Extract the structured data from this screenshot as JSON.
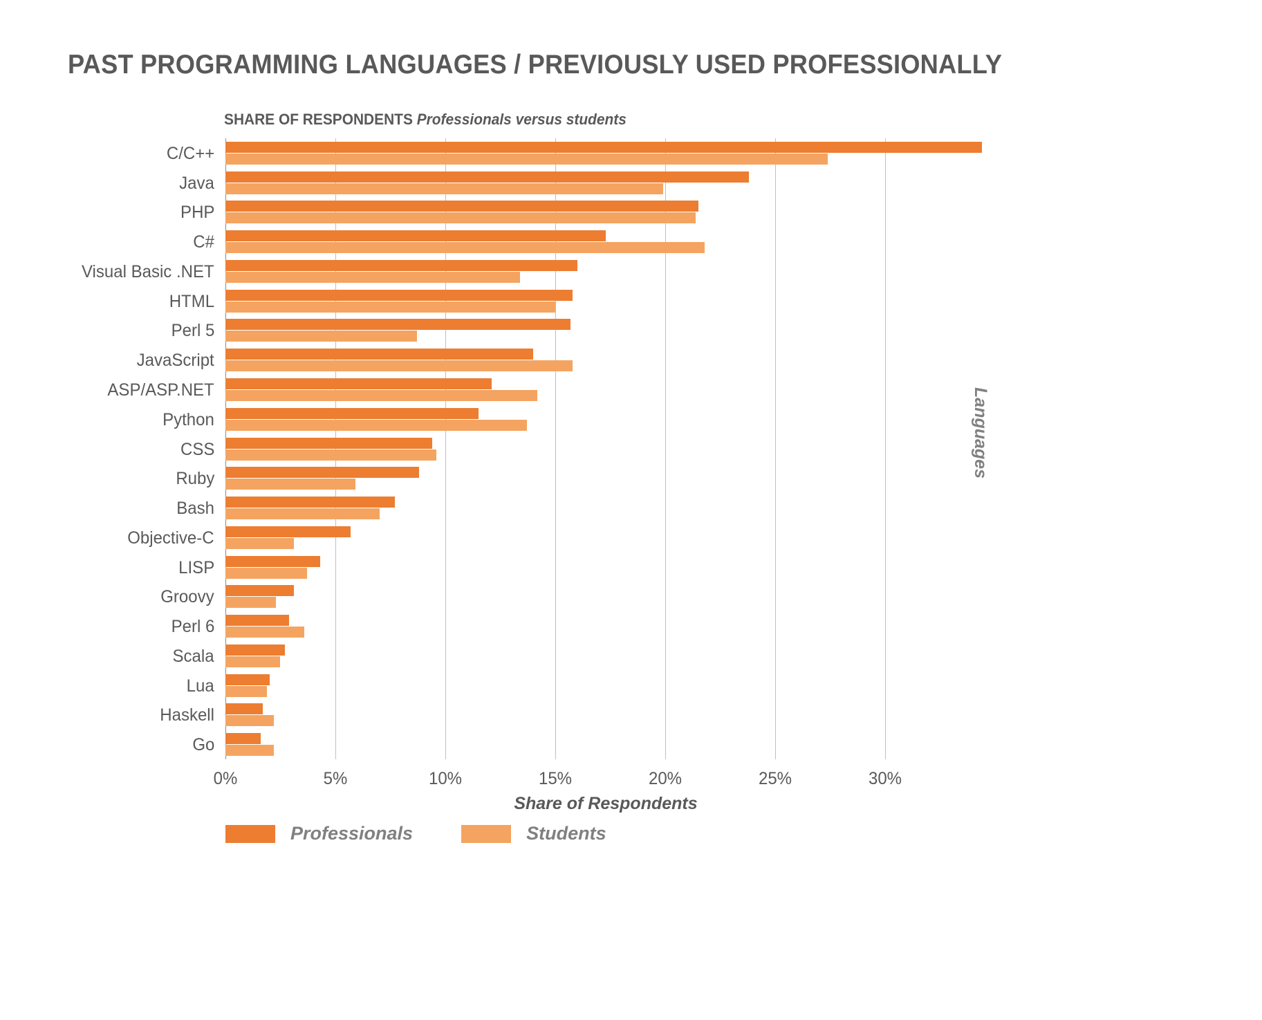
{
  "title": "PAST PROGRAMMING LANGUAGES / PREVIOUSLY USED PROFESSIONALLY",
  "subtitle": {
    "strong": "SHARE OF RESPONDENTS",
    "em": "Professionals versus students"
  },
  "axis": {
    "x_title": "Share of Respondents",
    "y_title": "Languages"
  },
  "legend": [
    {
      "label": "Professionals",
      "color": "#ED7D31"
    },
    {
      "label": "Students",
      "color": "#F4A460"
    }
  ],
  "colors": {
    "professionals": "#ED7D31",
    "students": "#F4A460",
    "text": "#595959",
    "gridline": "#bfbfbf",
    "axis": "#8c8c8c"
  },
  "chart_data": {
    "type": "bar",
    "orientation": "horizontal",
    "title": "PAST PROGRAMMING LANGUAGES / PREVIOUSLY USED PROFESSIONALLY",
    "subtitle": "SHARE OF RESPONDENTS Professionals versus students",
    "xlabel": "Share of Respondents",
    "ylabel": "Languages",
    "xlim": [
      0,
      34.6
    ],
    "xticks": [
      0,
      5,
      10,
      15,
      20,
      25,
      30
    ],
    "xtick_labels": [
      "0%",
      "5%",
      "10%",
      "15%",
      "20%",
      "25%",
      "30%"
    ],
    "grid": true,
    "legend_position": "bottom-left",
    "categories": [
      "C/C++",
      "Java",
      "PHP",
      "C#",
      "Visual Basic .NET",
      "HTML",
      "Perl 5",
      "JavaScript",
      "ASP/ASP.NET",
      "Python",
      "CSS",
      "Ruby",
      "Bash",
      "Objective-C",
      "LISP",
      "Groovy",
      "Perl 6",
      "Scala",
      "Lua",
      "Haskell",
      "Go"
    ],
    "series": [
      {
        "name": "Professionals",
        "color": "#ED7D31",
        "values": [
          34.4,
          23.8,
          21.5,
          17.3,
          16.0,
          15.8,
          15.7,
          14.0,
          12.1,
          11.5,
          9.4,
          8.8,
          7.7,
          5.7,
          4.3,
          3.1,
          2.9,
          2.7,
          2.0,
          1.7,
          1.6
        ]
      },
      {
        "name": "Students",
        "color": "#F4A460",
        "values": [
          27.4,
          19.9,
          21.4,
          21.8,
          13.4,
          15.0,
          8.7,
          15.8,
          14.2,
          13.7,
          9.6,
          5.9,
          7.0,
          3.1,
          3.7,
          2.3,
          3.6,
          2.5,
          1.9,
          2.2,
          2.2
        ]
      }
    ]
  }
}
